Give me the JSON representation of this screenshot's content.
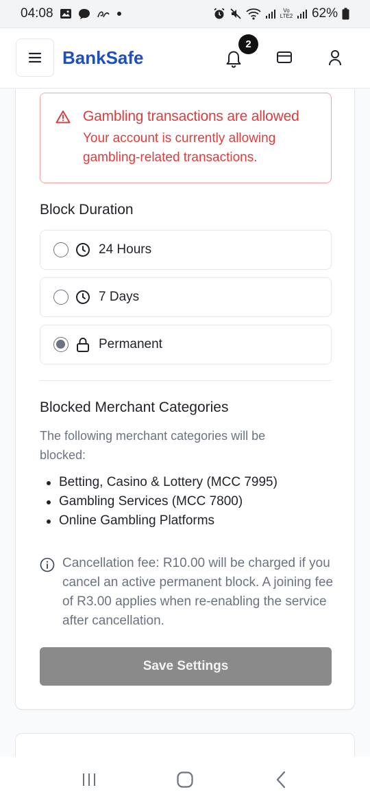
{
  "status_bar": {
    "time": "04:08",
    "battery": "62%",
    "network_label": "Vo LTE2"
  },
  "header": {
    "brand": "BankSafe",
    "notification_count": "2"
  },
  "alert": {
    "title": "Gambling transactions are allowed",
    "body": "Your account is currently allowing gambling-related transactions."
  },
  "block_duration": {
    "title": "Block Duration",
    "options": [
      {
        "label": "24 Hours",
        "icon": "clock-icon",
        "selected": false
      },
      {
        "label": "7 Days",
        "icon": "clock-icon",
        "selected": false
      },
      {
        "label": "Permanent",
        "icon": "lock-icon",
        "selected": true
      }
    ]
  },
  "merchant_categories": {
    "title": "Blocked Merchant Categories",
    "description": "The following merchant categories will be blocked:",
    "items": [
      "Betting, Casino & Lottery (MCC 7995)",
      "Gambling Services (MCC 7800)",
      "Online Gambling Platforms"
    ]
  },
  "fee_notice": "Cancellation fee: R10.00 will be charged if you cancel an active permanent block. A joining fee of R3.00 applies when re-enabling the service after cancellation.",
  "save_button": "Save Settings",
  "colors": {
    "brand": "#1f4fbd",
    "alert": "#dc3d3d",
    "button_disabled": "#8a8a8a"
  }
}
